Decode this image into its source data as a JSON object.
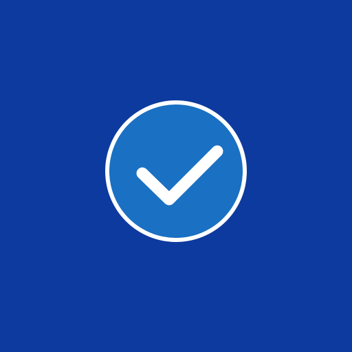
{
  "colors": {
    "background": "#0d3a9e",
    "badge_fill": "#1a70c2",
    "badge_ring": "#ffffff",
    "check": "#ffffff"
  },
  "icon": "check-circle-icon"
}
